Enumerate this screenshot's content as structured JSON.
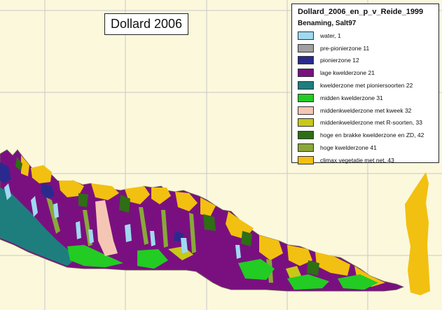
{
  "map": {
    "title": "Dollard 2006"
  },
  "legend": {
    "title": "Dollard_2006_en_p_v_Reide_1999",
    "subtitle": "Benaming, Salt97",
    "items": [
      {
        "label": "water, 1",
        "color": "#9fd9f0"
      },
      {
        "label": "pre-pionierzone 11",
        "color": "#a0a0a0"
      },
      {
        "label": "pionierzone 12",
        "color": "#2a2a8e"
      },
      {
        "label": "lage kwelderzone 21",
        "color": "#7a1080"
      },
      {
        "label": "kwelderzone met pioniersoorten 22",
        "color": "#1e7e7e"
      },
      {
        "label": "midden kwelderzone 31",
        "color": "#22cc22"
      },
      {
        "label": "middenkwelderzone met kweek 32",
        "color": "#f5c6b4"
      },
      {
        "label": "middenkwelderzone met R-soorten, 33",
        "color": "#c8c818"
      },
      {
        "label": "hoge en brakke kwelderzone en ZD, 42",
        "color": "#2e6e14"
      },
      {
        "label": "hoge kwelderzone 41",
        "color": "#8aa83a"
      },
      {
        "label": "climax vegetatie met net, 43",
        "color": "#f2c010"
      }
    ]
  },
  "colors": {
    "land": "#fbf8dc",
    "grid": "#c8c8c8",
    "water": "#9fd9f0",
    "pionier": "#2a2a8e",
    "lage": "#7a1080",
    "kwelder_pionier": "#1e7e7e",
    "midden": "#22cc22",
    "kweek": "#f5c6b4",
    "hoge_brak": "#2e6e14",
    "hoge": "#8aa83a",
    "climax": "#f2c010"
  }
}
